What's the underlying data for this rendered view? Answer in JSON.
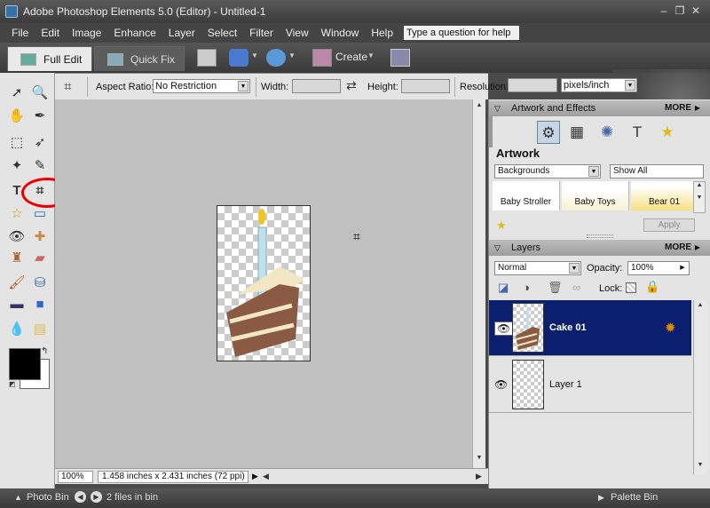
{
  "titlebar": {
    "title": "Adobe Photoshop Elements 5.0 (Editor) - Untitled-1",
    "minimize": "–",
    "restore": "❐",
    "close": "✕"
  },
  "menubar": {
    "items": [
      "File",
      "Edit",
      "Image",
      "Enhance",
      "Layer",
      "Select",
      "Filter",
      "View",
      "Window",
      "Help"
    ],
    "help_box": "Type a question for help"
  },
  "modebar": {
    "full_edit": "Full Edit",
    "quick_fix": "Quick Fix",
    "create": "Create"
  },
  "options": {
    "aspect_label": "Aspect Ratio:",
    "aspect_value": "No Restriction",
    "width_label": "Width:",
    "width_value": "",
    "swap_icon": "⇄",
    "height_label": "Height:",
    "height_value": "",
    "resolution_label": "Resolution:",
    "resolution_value": "",
    "units_value": "pixels/inch"
  },
  "statusbar": {
    "zoom": "100%",
    "doc_info": "1.458 inches x 2.431 inches (72 ppi)"
  },
  "bottombar": {
    "photo_bin": "Photo Bin",
    "files_in_bin": "2 files in bin",
    "palette_bin": "Palette Bin"
  },
  "palette": {
    "artwork_panel": {
      "title": "Artwork and Effects",
      "more": "MORE",
      "section_title": "Artwork",
      "category": "Backgrounds",
      "filter": "Show All",
      "thumbnails": [
        "Baby Stroller",
        "Baby Toys",
        "Bear 01"
      ],
      "apply": "Apply"
    },
    "layers_panel": {
      "title": "Layers",
      "more": "MORE",
      "blend_mode": "Normal",
      "opacity_label": "Opacity:",
      "opacity_value": "100%",
      "lock_label": "Lock:",
      "layers": [
        {
          "name": "Cake 01",
          "selected": true
        },
        {
          "name": "Layer 1",
          "selected": false
        }
      ]
    }
  },
  "colors": {
    "selection": "#0a1f6e",
    "highlight_circle": "#e00000"
  }
}
